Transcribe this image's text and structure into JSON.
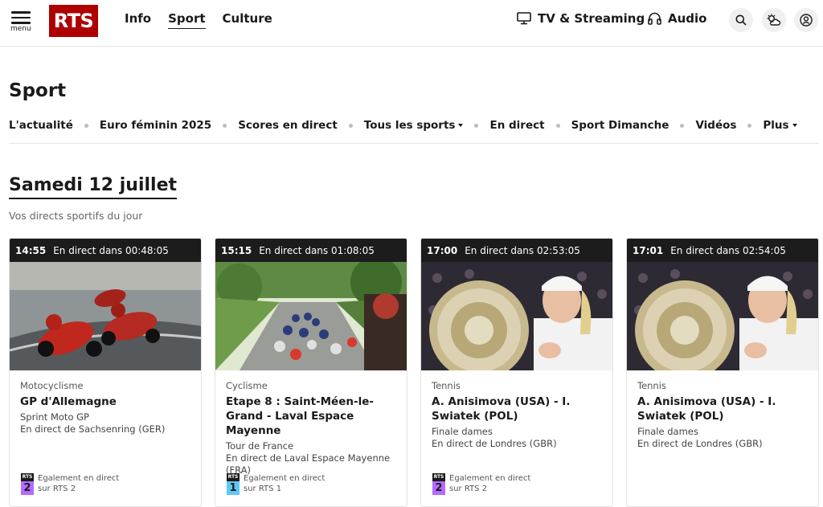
{
  "header": {
    "menu_label": "menu",
    "logo": "RTS",
    "nav": [
      {
        "label": "Info",
        "active": false
      },
      {
        "label": "Sport",
        "active": true
      },
      {
        "label": "Culture",
        "active": false
      }
    ],
    "tv_label": "TV & Streaming",
    "audio_label": "Audio",
    "icons": [
      "search-icon",
      "weather-icon",
      "account-icon"
    ]
  },
  "page": {
    "title": "Sport",
    "subnav": [
      {
        "label": "L'actualité",
        "caret": false
      },
      {
        "label": "Euro féminin 2025",
        "caret": false
      },
      {
        "label": "Scores en direct",
        "caret": false
      },
      {
        "label": "Tous les sports",
        "caret": true
      },
      {
        "label": "En direct",
        "caret": false
      },
      {
        "label": "Sport Dimanche",
        "caret": false
      },
      {
        "label": "Vidéos",
        "caret": false
      },
      {
        "label": "Plus",
        "caret": true
      }
    ],
    "day_title": "Samedi 12 juillet",
    "day_subtitle": "Vos directs sportifs du jour"
  },
  "cards": [
    {
      "time": "14:55",
      "status": "En direct dans 00:48:05",
      "category": "Motocyclisme",
      "title": "GP d'Allemagne",
      "lines": [
        "Sprint Moto GP",
        "En direct de Sachsenring (GER)"
      ],
      "also": {
        "text1": "Egalement en direct",
        "text2": "sur RTS 2",
        "channel_label": "RTS",
        "channel_number": "2",
        "channel_color": "#b36bff"
      }
    },
    {
      "time": "15:15",
      "status": "En direct dans 01:08:05",
      "category": "Cyclisme",
      "title": "Etape 8 : Saint-Méen-le-Grand - Laval Espace Mayenne",
      "lines": [
        "Tour de France",
        "En direct de Laval Espace Mayenne (FRA)"
      ],
      "also": {
        "text1": "Egalement en direct",
        "text2": "sur RTS 1",
        "channel_label": "RTS",
        "channel_number": "1",
        "channel_color": "#5ec8f2"
      }
    },
    {
      "time": "17:00",
      "status": "En direct dans 02:53:05",
      "category": "Tennis",
      "title": "A. Anisimova (USA) - I. Swiatek (POL)",
      "lines": [
        "Finale dames",
        "En direct de Londres (GBR)"
      ],
      "also": {
        "text1": "Egalement en direct",
        "text2": "sur RTS 2",
        "channel_label": "RTS",
        "channel_number": "2",
        "channel_color": "#b36bff"
      }
    },
    {
      "time": "17:01",
      "status": "En direct dans 02:54:05",
      "category": "Tennis",
      "title": "A. Anisimova (USA) - I. Swiatek (POL)",
      "lines": [
        "Finale dames",
        "En direct de Londres (GBR)"
      ],
      "also": null
    }
  ]
}
